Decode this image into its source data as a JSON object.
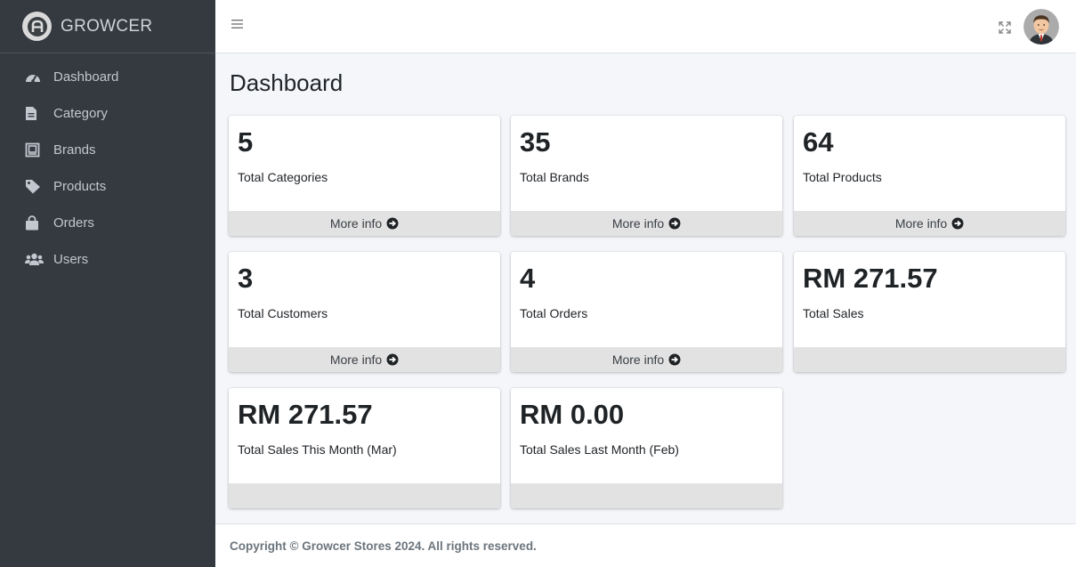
{
  "brand": {
    "name": "GROWCER"
  },
  "sidebar": {
    "items": [
      {
        "label": "Dashboard",
        "icon": "tachometer-icon"
      },
      {
        "label": "Category",
        "icon": "file-icon"
      },
      {
        "label": "Brands",
        "icon": "brand-box-icon"
      },
      {
        "label": "Products",
        "icon": "tag-icon"
      },
      {
        "label": "Orders",
        "icon": "shopping-bag-icon"
      },
      {
        "label": "Users",
        "icon": "users-icon"
      }
    ]
  },
  "topbar": {
    "menu_icon": "hamburger-icon",
    "fullscreen_icon": "expand-arrows-icon",
    "avatar_icon": "user-avatar-icon"
  },
  "page": {
    "title": "Dashboard"
  },
  "cards": [
    {
      "value": "5",
      "label": "Total Categories",
      "footer": "More info"
    },
    {
      "value": "35",
      "label": "Total Brands",
      "footer": "More info"
    },
    {
      "value": "64",
      "label": "Total Products",
      "footer": "More info"
    },
    {
      "value": "3",
      "label": "Total Customers",
      "footer": "More info"
    },
    {
      "value": "4",
      "label": "Total Orders",
      "footer": "More info"
    },
    {
      "value": "RM 271.57",
      "label": "Total Sales",
      "footer": ""
    },
    {
      "value": "RM 271.57",
      "label": "Total Sales This Month (Mar)",
      "footer": ""
    },
    {
      "value": "RM 0.00",
      "label": "Total Sales Last Month (Feb)",
      "footer": ""
    }
  ],
  "footer": {
    "text": "Copyright © Growcer Stores 2024. All rights reserved."
  },
  "colors": {
    "sidebar_bg": "#343a40",
    "page_bg": "#f4f6f9",
    "card_footer_bg": "#e2e2e2"
  }
}
